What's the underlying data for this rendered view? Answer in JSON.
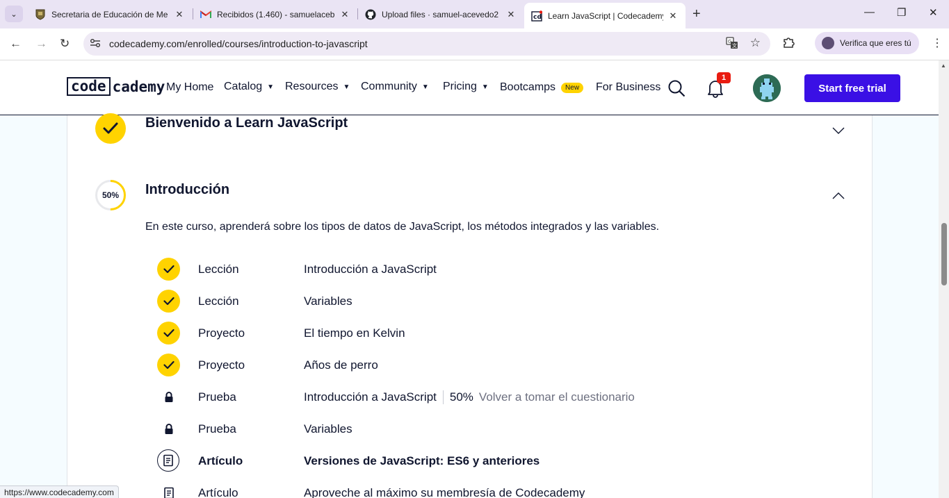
{
  "browser": {
    "tabs": [
      {
        "title": "Secretaria de Educación de Me",
        "favicon": "school-crest-icon"
      },
      {
        "title": "Recibidos (1.460) - samuelaceb",
        "favicon": "gmail-icon"
      },
      {
        "title": "Upload files · samuel-acevedo2",
        "favicon": "github-icon"
      },
      {
        "title": "Learn JavaScript | Codecademy",
        "favicon": "codecademy-icon"
      }
    ],
    "active_tab": 3,
    "url": "codecademy.com/enrolled/courses/introduction-to-javascript",
    "verify_label": "Verifica que eres tú",
    "status_url": "https://www.codecademy.com"
  },
  "site": {
    "logo_boxed": "code",
    "logo_rest": "cademy",
    "nav": {
      "my_home": "My Home",
      "catalog": "Catalog",
      "resources": "Resources",
      "community": "Community",
      "pricing": "Pricing",
      "bootcamps": "Bootcamps",
      "new_badge": "New",
      "for_business": "For Business"
    },
    "notification_count": "1",
    "cta_label": "Start free trial",
    "colors": {
      "brand": "#3a10e5",
      "accent": "#ffd300",
      "ink": "#10162f",
      "alert": "#e91c11"
    }
  },
  "modules": {
    "welcome": {
      "title": "Bienvenido a Learn JavaScript",
      "completed": true
    },
    "intro": {
      "title": "Introducción",
      "progress_label": "50%",
      "progress": 0.5,
      "description": "En este curso, aprenderá sobre los tipos de datos de JavaScript, los métodos integrados y las variables.",
      "items": [
        {
          "type": "Lección",
          "name": "Introducción a JavaScript",
          "status": "done"
        },
        {
          "type": "Lección",
          "name": "Variables",
          "status": "done"
        },
        {
          "type": "Proyecto",
          "name": "El tiempo en Kelvin",
          "status": "done"
        },
        {
          "type": "Proyecto",
          "name": "Años de perro",
          "status": "done"
        },
        {
          "type": "Prueba",
          "name": "Introducción a JavaScript",
          "status": "locked",
          "score": "50%",
          "retake": "Volver a tomar el cuestionario"
        },
        {
          "type": "Prueba",
          "name": "Variables",
          "status": "locked"
        },
        {
          "type": "Artículo",
          "name": "Versiones de JavaScript: ES6 y anteriores",
          "status": "article-current"
        },
        {
          "type": "Artículo",
          "name": "Aproveche al máximo su membresía de Codecademy",
          "status": "article"
        }
      ]
    }
  }
}
